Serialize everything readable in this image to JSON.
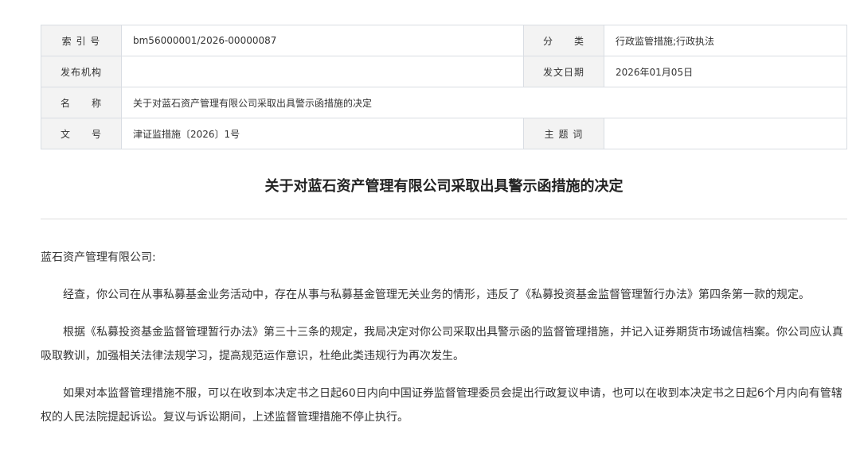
{
  "meta": {
    "rows": [
      {
        "l1": "索 引 号",
        "v1": "bm56000001/2026-00000087",
        "l2": "分　　类",
        "v2": "行政监管措施;行政执法"
      },
      {
        "l1": "发布机构",
        "v1": "",
        "l2": "发文日期",
        "v2": "2026年01月05日"
      },
      {
        "l1": "名　　称",
        "v1": "关于对蓝石资产管理有限公司采取出具警示函措施的决定"
      },
      {
        "l1": "文　　号",
        "v1": "津证监措施〔2026〕1号",
        "l2": "主 题 词",
        "v2": ""
      }
    ]
  },
  "title": "关于对蓝石资产管理有限公司采取出具警示函措施的决定",
  "body": {
    "salutation": "蓝石资产管理有限公司:",
    "paragraphs": [
      "经查，你公司在从事私募基金业务活动中，存在从事与私募基金管理无关业务的情形，违反了《私募投资基金监督管理暂行办法》第四条第一款的规定。",
      "根据《私募投资基金监督管理暂行办法》第三十三条的规定，我局决定对你公司采取出具警示函的监督管理措施，并记入证券期货市场诚信档案。你公司应认真吸取教训，加强相关法律法规学习，提高规范运作意识，杜绝此类违规行为再次发生。",
      "如果对本监督管理措施不服，可以在收到本决定书之日起60日内向中国证券监督管理委员会提出行政复议申请，也可以在收到本决定书之日起6个月内向有管辖权的人民法院提起诉讼。复议与诉讼期间，上述监督管理措施不停止执行。"
    ]
  }
}
